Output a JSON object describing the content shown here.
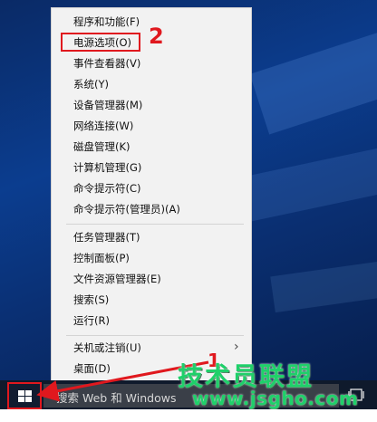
{
  "menu": {
    "items": [
      {
        "label": "程序和功能(F)"
      },
      {
        "label": "电源选项(O)"
      },
      {
        "label": "事件查看器(V)"
      },
      {
        "label": "系统(Y)"
      },
      {
        "label": "设备管理器(M)"
      },
      {
        "label": "网络连接(W)"
      },
      {
        "label": "磁盘管理(K)"
      },
      {
        "label": "计算机管理(G)"
      },
      {
        "label": "命令提示符(C)"
      },
      {
        "label": "命令提示符(管理员)(A)"
      },
      {
        "label": "任务管理器(T)"
      },
      {
        "label": "控制面板(P)"
      },
      {
        "label": "文件资源管理器(E)"
      },
      {
        "label": "搜索(S)"
      },
      {
        "label": "运行(R)"
      },
      {
        "label": "关机或注销(U)"
      },
      {
        "label": "桌面(D)"
      }
    ]
  },
  "annotations": {
    "step1": "1",
    "step2": "2",
    "color": "#e0181e"
  },
  "taskbar": {
    "search_placeholder": "搜索 Web 和 Windows",
    "start_icon": "windows-logo-icon",
    "taskview_icon": "task-view-icon"
  },
  "watermark": {
    "brand": "技术员联盟",
    "url": "www.jsgho.com",
    "color": "#1fd06a"
  }
}
